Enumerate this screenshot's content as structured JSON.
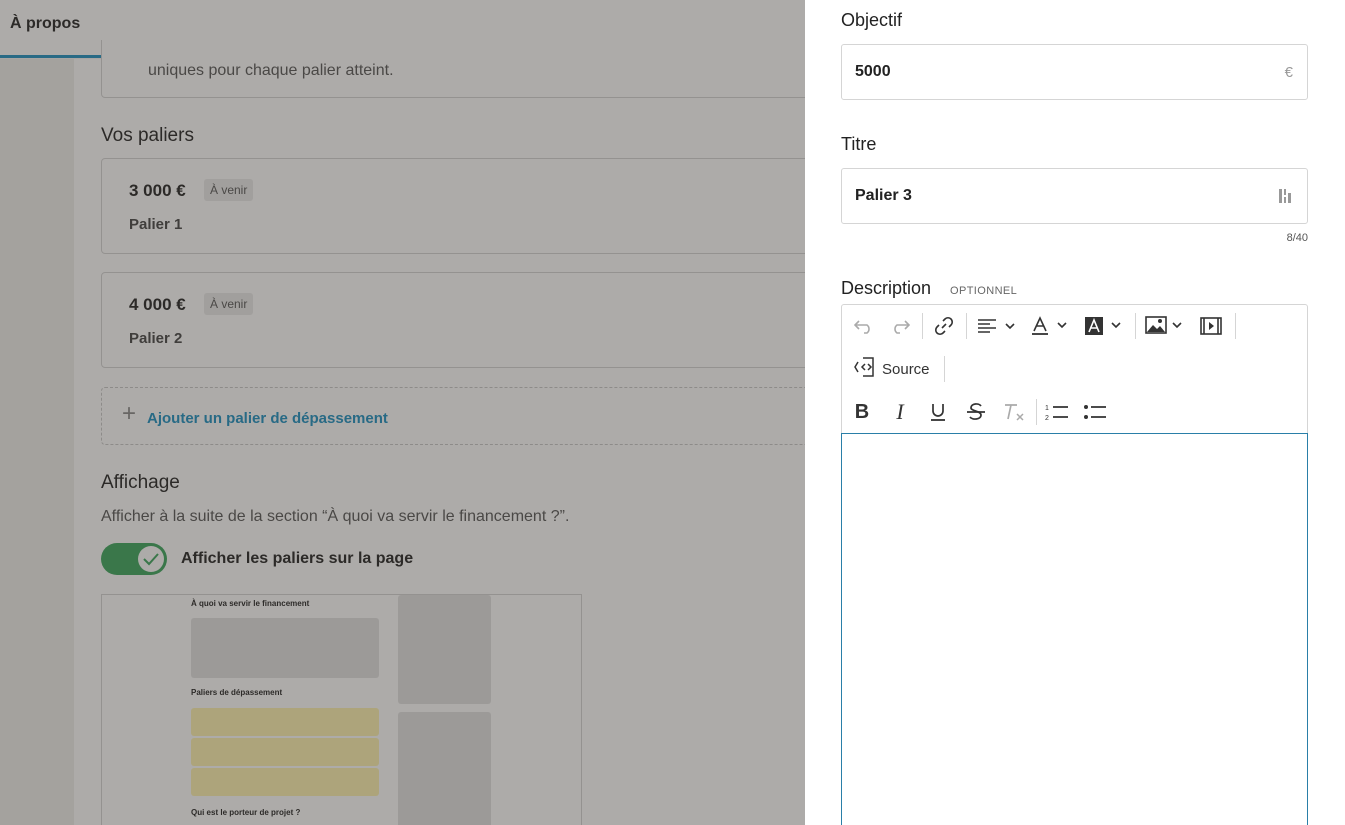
{
  "header": {
    "title": "À propos"
  },
  "intro_card": {
    "text": "uniques pour chaque palier atteint."
  },
  "tiers_section": {
    "title": "Vos paliers",
    "tiers": [
      {
        "amount": "3 000 €",
        "badge": "À venir",
        "name": "Palier 1"
      },
      {
        "amount": "4 000 €",
        "badge": "À venir",
        "name": "Palier 2"
      }
    ],
    "add_label": "Ajouter un palier de dépassement"
  },
  "display_section": {
    "title": "Affichage",
    "description": "Afficher à la suite de la section “À quoi va servir le financement ?”.",
    "toggle_label": "Afficher les paliers sur la page",
    "toggle_on": true,
    "toggle_color": "#3aa65c",
    "preview": {
      "label_1": "À quoi va servir le financement",
      "label_2": "Paliers de dépassement",
      "label_3": "Qui est le porteur de projet ?"
    }
  },
  "panel": {
    "objective": {
      "label": "Objectif",
      "value": "5000",
      "suffix": "€"
    },
    "title_field": {
      "label": "Titre",
      "value": "Palier 3",
      "counter": "8/40"
    },
    "description": {
      "label": "Description",
      "optional": "OPTIONNEL",
      "source_label": "Source",
      "toolbar_icons": [
        "undo-icon",
        "redo-icon",
        "link-icon",
        "align-icon",
        "font-color-icon",
        "background-color-icon",
        "image-icon",
        "media-embed-icon",
        "source-icon",
        "bold-icon",
        "italic-icon",
        "underline-icon",
        "strikethrough-icon",
        "remove-format-icon",
        "numbered-list-icon",
        "bulleted-list-icon"
      ]
    }
  },
  "colors": {
    "accent": "#1b8fc2",
    "editor_focus": "#2a7fa8"
  }
}
